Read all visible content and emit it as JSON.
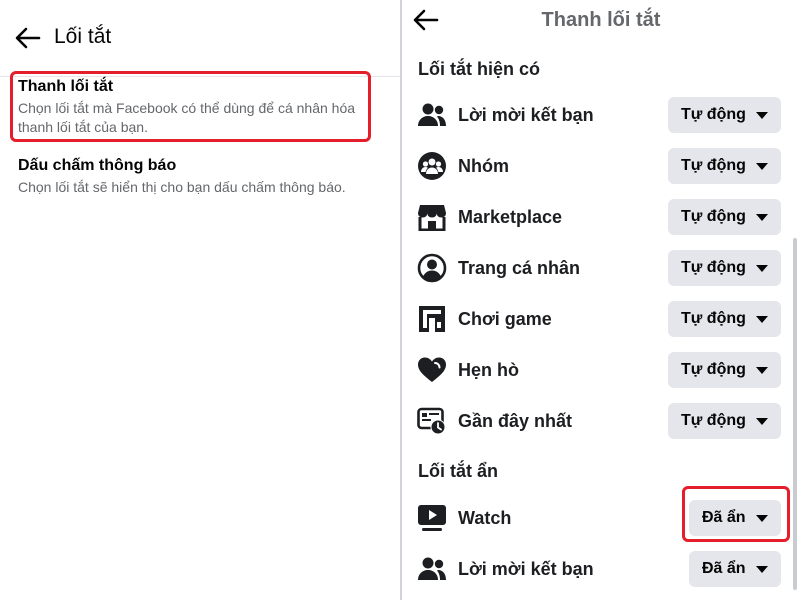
{
  "left": {
    "title": "Lối tắt",
    "options": [
      {
        "title": "Thanh lối tắt",
        "description": "Chọn lối tắt mà Facebook có thể dùng để cá nhân hóa thanh lối tắt của bạn."
      },
      {
        "title": "Dấu chấm thông báo",
        "description": "Chọn lối tắt sẽ hiển thị cho bạn dấu chấm thông báo."
      }
    ]
  },
  "right": {
    "title": "Thanh lối tắt",
    "visible_section": "Lối tắt hiện có",
    "hidden_section": "Lối tắt ẩn",
    "visible_items": [
      {
        "label": "Lời mời kết bạn",
        "value": "Tự động",
        "icon": "friends-icon"
      },
      {
        "label": "Nhóm",
        "value": "Tự động",
        "icon": "groups-icon"
      },
      {
        "label": "Marketplace",
        "value": "Tự động",
        "icon": "marketplace-icon"
      },
      {
        "label": "Trang cá nhân",
        "value": "Tự động",
        "icon": "profile-icon"
      },
      {
        "label": "Chơi game",
        "value": "Tự động",
        "icon": "gaming-icon"
      },
      {
        "label": "Hẹn hò",
        "value": "Tự động",
        "icon": "dating-icon"
      },
      {
        "label": "Gần đây nhất",
        "value": "Tự động",
        "icon": "most-recent-icon"
      }
    ],
    "hidden_items": [
      {
        "label": "Watch",
        "value": "Đã ẩn",
        "icon": "watch-icon"
      },
      {
        "label": "Lời mời kết bạn",
        "value": "Đã ẩn",
        "icon": "friends-icon"
      }
    ]
  },
  "colors": {
    "highlight": "#e41e2b",
    "dropdown_bg": "#e4e6eb",
    "secondary_text": "#65676b"
  }
}
